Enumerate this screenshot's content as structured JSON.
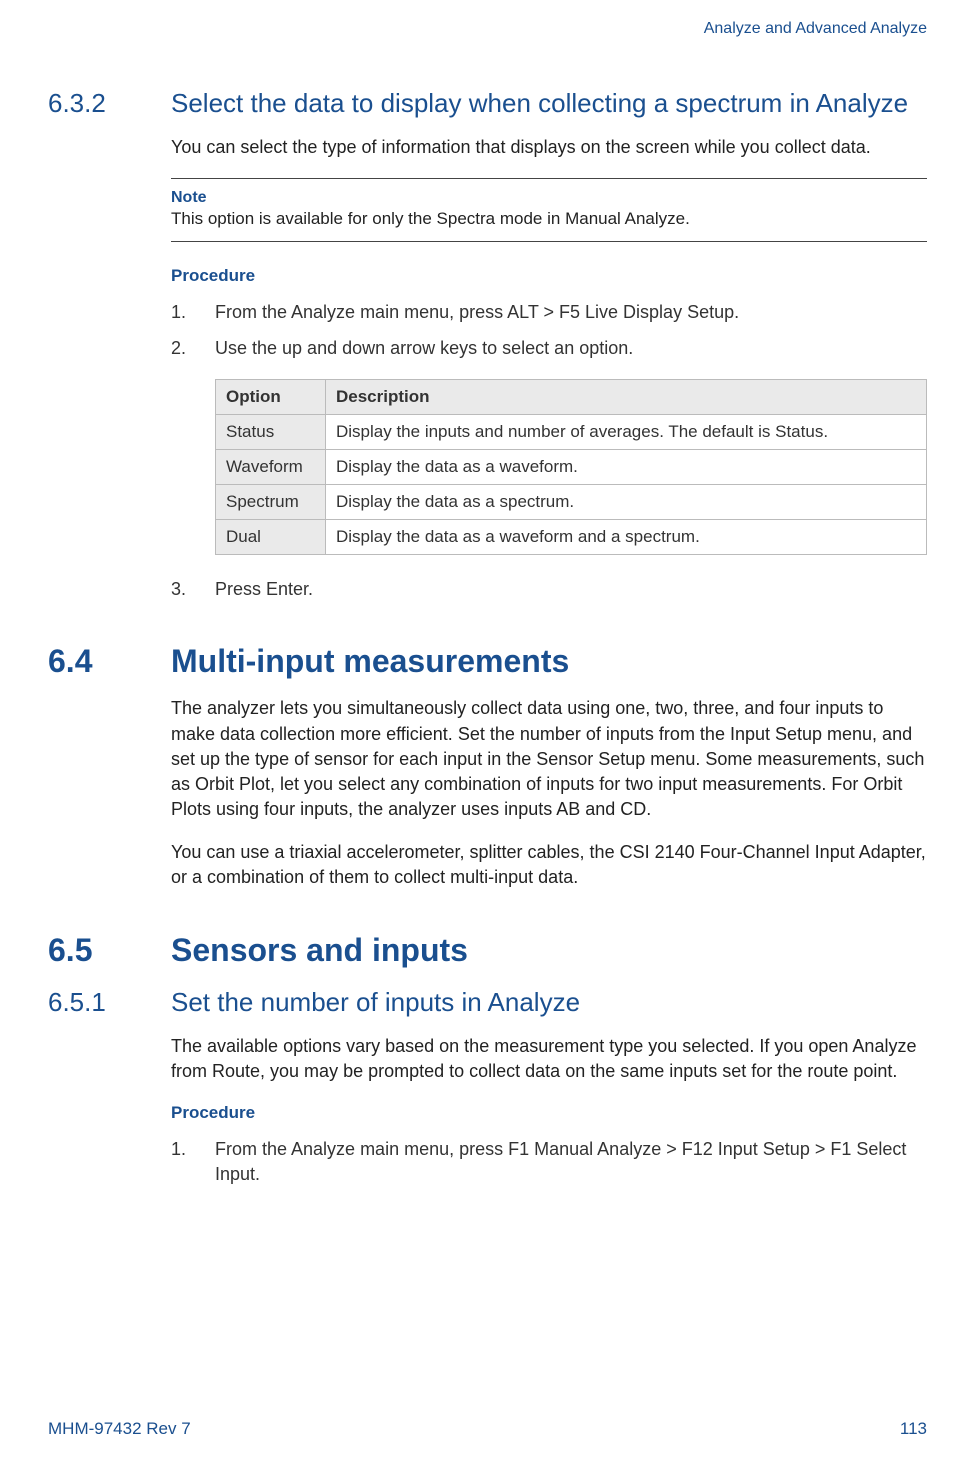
{
  "header": {
    "chapter_title": "Analyze and Advanced Analyze"
  },
  "section_632": {
    "number": "6.3.2",
    "title": "Select the data to display when collecting a spectrum in Analyze",
    "intro": "You can select the type of information that displays on the screen while you collect data.",
    "note_label": "Note",
    "note_text_1": "This option is available for only the ",
    "note_spectra": "Spectra",
    "note_text_2": " mode in ",
    "note_manual": "Manual Analyze",
    "note_text_3": ".",
    "procedure_label": "Procedure",
    "steps": {
      "s1_num": "1.",
      "s1_a": "From the Analyze main menu, press ",
      "s1_alt": "ALT",
      "s1_b": " > ",
      "s1_f5": "F5 Live Display Setup",
      "s1_c": ".",
      "s2_num": "2.",
      "s2_text": "Use the up and down arrow keys to select an option.",
      "s3_num": "3.",
      "s3_a": "Press ",
      "s3_enter": "Enter",
      "s3_b": "."
    },
    "table": {
      "head_option": "Option",
      "head_desc": "Description",
      "rows": {
        "r1_opt": "Status",
        "r1_desc_a": "Display the inputs and number of averages. The default is ",
        "r1_desc_b": "Status",
        "r1_desc_c": ".",
        "r2_opt": "Waveform",
        "r2_desc": "Display the data as a waveform.",
        "r3_opt": "Spectrum",
        "r3_desc": "Display the data as a spectrum.",
        "r4_opt": "Dual",
        "r4_desc": "Display the data as a waveform and a spectrum."
      }
    }
  },
  "section_64": {
    "number": "6.4",
    "title": "Multi-input measurements",
    "para1": "The analyzer lets you simultaneously collect data using one, two, three, and four inputs to make data collection more efficient. Set the number of inputs from the Input Setup menu, and set up the type of sensor for each input in the Sensor Setup menu. Some measurements, such as Orbit Plot, let you select any combination of inputs for two input measurements. For Orbit Plots using four inputs, the analyzer uses inputs AB and CD.",
    "para2": "You can use a triaxial accelerometer, splitter cables, the CSI 2140 Four-Channel Input Adapter, or a combination of them to collect multi-input data."
  },
  "section_65": {
    "number": "6.5",
    "title": "Sensors and inputs"
  },
  "section_651": {
    "number": "6.5.1",
    "title": "Set the number of inputs in Analyze",
    "para1": "The available options vary based on the measurement type you selected. If you open Analyze from Route, you may be prompted to collect data on the same inputs set for the route point.",
    "procedure_label": "Procedure",
    "steps": {
      "s1_num": "1.",
      "s1_a": "From the Analyze main menu, press ",
      "s1_f1": "F1 Manual Analyze",
      "s1_b": " > ",
      "s1_f12": "F12 Input Setup",
      "s1_c": " > ",
      "s1_f1b": "F1 Select Input",
      "s1_d": "."
    }
  },
  "footer": {
    "doc_id": "MHM-97432 Rev 7",
    "page_num": "113"
  }
}
